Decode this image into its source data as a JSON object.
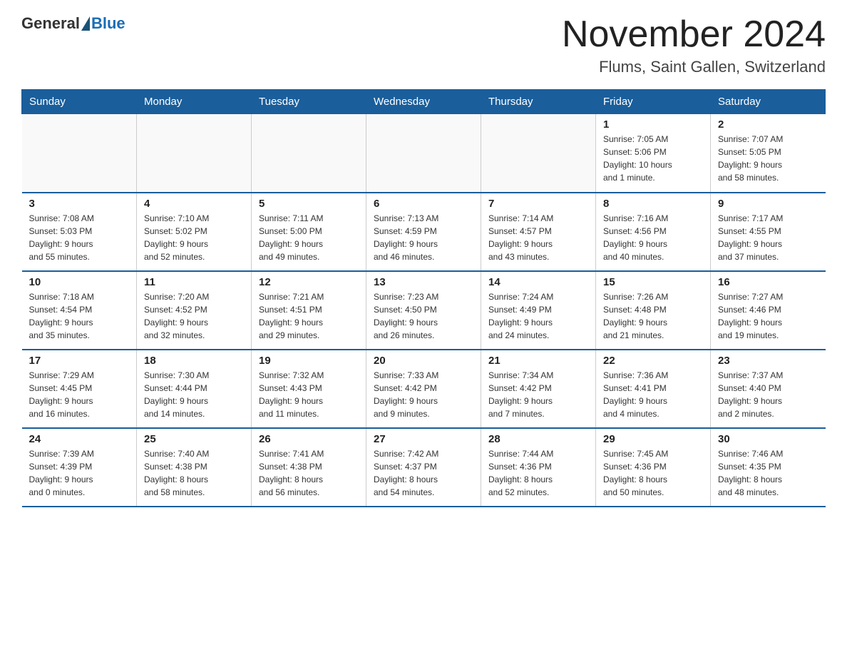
{
  "logo": {
    "general": "General",
    "blue": "Blue"
  },
  "title": "November 2024",
  "subtitle": "Flums, Saint Gallen, Switzerland",
  "days_of_week": [
    "Sunday",
    "Monday",
    "Tuesday",
    "Wednesday",
    "Thursday",
    "Friday",
    "Saturday"
  ],
  "weeks": [
    [
      {
        "day": "",
        "info": ""
      },
      {
        "day": "",
        "info": ""
      },
      {
        "day": "",
        "info": ""
      },
      {
        "day": "",
        "info": ""
      },
      {
        "day": "",
        "info": ""
      },
      {
        "day": "1",
        "info": "Sunrise: 7:05 AM\nSunset: 5:06 PM\nDaylight: 10 hours\nand 1 minute."
      },
      {
        "day": "2",
        "info": "Sunrise: 7:07 AM\nSunset: 5:05 PM\nDaylight: 9 hours\nand 58 minutes."
      }
    ],
    [
      {
        "day": "3",
        "info": "Sunrise: 7:08 AM\nSunset: 5:03 PM\nDaylight: 9 hours\nand 55 minutes."
      },
      {
        "day": "4",
        "info": "Sunrise: 7:10 AM\nSunset: 5:02 PM\nDaylight: 9 hours\nand 52 minutes."
      },
      {
        "day": "5",
        "info": "Sunrise: 7:11 AM\nSunset: 5:00 PM\nDaylight: 9 hours\nand 49 minutes."
      },
      {
        "day": "6",
        "info": "Sunrise: 7:13 AM\nSunset: 4:59 PM\nDaylight: 9 hours\nand 46 minutes."
      },
      {
        "day": "7",
        "info": "Sunrise: 7:14 AM\nSunset: 4:57 PM\nDaylight: 9 hours\nand 43 minutes."
      },
      {
        "day": "8",
        "info": "Sunrise: 7:16 AM\nSunset: 4:56 PM\nDaylight: 9 hours\nand 40 minutes."
      },
      {
        "day": "9",
        "info": "Sunrise: 7:17 AM\nSunset: 4:55 PM\nDaylight: 9 hours\nand 37 minutes."
      }
    ],
    [
      {
        "day": "10",
        "info": "Sunrise: 7:18 AM\nSunset: 4:54 PM\nDaylight: 9 hours\nand 35 minutes."
      },
      {
        "day": "11",
        "info": "Sunrise: 7:20 AM\nSunset: 4:52 PM\nDaylight: 9 hours\nand 32 minutes."
      },
      {
        "day": "12",
        "info": "Sunrise: 7:21 AM\nSunset: 4:51 PM\nDaylight: 9 hours\nand 29 minutes."
      },
      {
        "day": "13",
        "info": "Sunrise: 7:23 AM\nSunset: 4:50 PM\nDaylight: 9 hours\nand 26 minutes."
      },
      {
        "day": "14",
        "info": "Sunrise: 7:24 AM\nSunset: 4:49 PM\nDaylight: 9 hours\nand 24 minutes."
      },
      {
        "day": "15",
        "info": "Sunrise: 7:26 AM\nSunset: 4:48 PM\nDaylight: 9 hours\nand 21 minutes."
      },
      {
        "day": "16",
        "info": "Sunrise: 7:27 AM\nSunset: 4:46 PM\nDaylight: 9 hours\nand 19 minutes."
      }
    ],
    [
      {
        "day": "17",
        "info": "Sunrise: 7:29 AM\nSunset: 4:45 PM\nDaylight: 9 hours\nand 16 minutes."
      },
      {
        "day": "18",
        "info": "Sunrise: 7:30 AM\nSunset: 4:44 PM\nDaylight: 9 hours\nand 14 minutes."
      },
      {
        "day": "19",
        "info": "Sunrise: 7:32 AM\nSunset: 4:43 PM\nDaylight: 9 hours\nand 11 minutes."
      },
      {
        "day": "20",
        "info": "Sunrise: 7:33 AM\nSunset: 4:42 PM\nDaylight: 9 hours\nand 9 minutes."
      },
      {
        "day": "21",
        "info": "Sunrise: 7:34 AM\nSunset: 4:42 PM\nDaylight: 9 hours\nand 7 minutes."
      },
      {
        "day": "22",
        "info": "Sunrise: 7:36 AM\nSunset: 4:41 PM\nDaylight: 9 hours\nand 4 minutes."
      },
      {
        "day": "23",
        "info": "Sunrise: 7:37 AM\nSunset: 4:40 PM\nDaylight: 9 hours\nand 2 minutes."
      }
    ],
    [
      {
        "day": "24",
        "info": "Sunrise: 7:39 AM\nSunset: 4:39 PM\nDaylight: 9 hours\nand 0 minutes."
      },
      {
        "day": "25",
        "info": "Sunrise: 7:40 AM\nSunset: 4:38 PM\nDaylight: 8 hours\nand 58 minutes."
      },
      {
        "day": "26",
        "info": "Sunrise: 7:41 AM\nSunset: 4:38 PM\nDaylight: 8 hours\nand 56 minutes."
      },
      {
        "day": "27",
        "info": "Sunrise: 7:42 AM\nSunset: 4:37 PM\nDaylight: 8 hours\nand 54 minutes."
      },
      {
        "day": "28",
        "info": "Sunrise: 7:44 AM\nSunset: 4:36 PM\nDaylight: 8 hours\nand 52 minutes."
      },
      {
        "day": "29",
        "info": "Sunrise: 7:45 AM\nSunset: 4:36 PM\nDaylight: 8 hours\nand 50 minutes."
      },
      {
        "day": "30",
        "info": "Sunrise: 7:46 AM\nSunset: 4:35 PM\nDaylight: 8 hours\nand 48 minutes."
      }
    ]
  ]
}
